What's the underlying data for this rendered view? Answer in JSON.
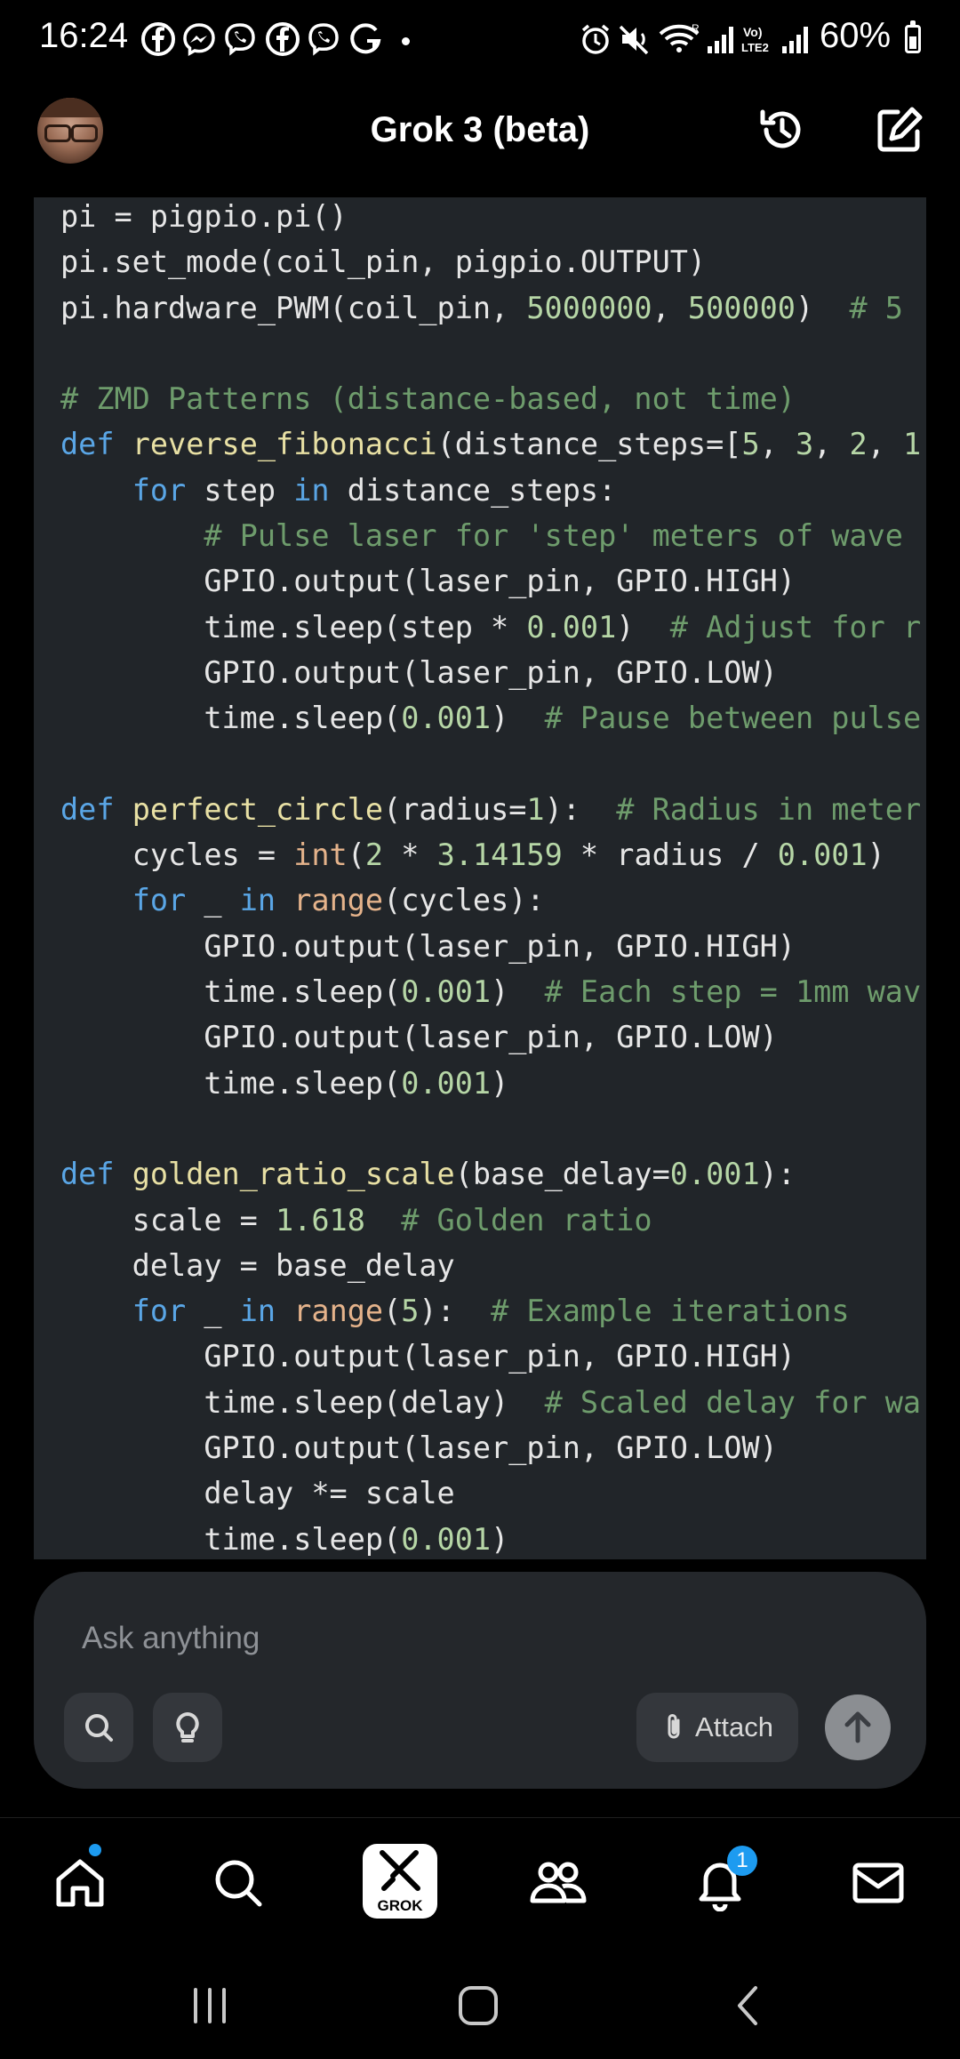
{
  "status_bar": {
    "time": "16:24",
    "battery": "60%",
    "notification_icons": [
      "facebook-icon",
      "messenger-icon",
      "viber-icon",
      "facebook-icon",
      "viber-icon",
      "grammarly-icon"
    ],
    "system_icons": [
      "alarm-icon",
      "mute-icon",
      "wifi-icon",
      "signal-icon",
      "volte-icon",
      "signal-icon"
    ]
  },
  "header": {
    "title": "Grok 3 (beta)"
  },
  "code": {
    "lines": [
      [
        {
          "t": "pi = pigpio.pi()",
          "c": ""
        }
      ],
      [
        {
          "t": "pi.set_mode(coil_pin, pigpio.OUTPUT)",
          "c": ""
        }
      ],
      [
        {
          "t": "pi.hardware_PWM(coil_pin, ",
          "c": ""
        },
        {
          "t": "5000000",
          "c": "num"
        },
        {
          "t": ", ",
          "c": ""
        },
        {
          "t": "500000",
          "c": "num"
        },
        {
          "t": ")  ",
          "c": ""
        },
        {
          "t": "# 5",
          "c": "cm"
        }
      ],
      [],
      [
        {
          "t": "# ZMD Patterns (distance-based, not time)",
          "c": "cm"
        }
      ],
      [
        {
          "t": "def ",
          "c": "kw"
        },
        {
          "t": "reverse_fibonacci",
          "c": "fn"
        },
        {
          "t": "(distance_steps=[",
          "c": ""
        },
        {
          "t": "5",
          "c": "num"
        },
        {
          "t": ", ",
          "c": ""
        },
        {
          "t": "3",
          "c": "num"
        },
        {
          "t": ", ",
          "c": ""
        },
        {
          "t": "2",
          "c": "num"
        },
        {
          "t": ", ",
          "c": ""
        },
        {
          "t": "1",
          "c": "num"
        }
      ],
      [
        {
          "t": "    ",
          "c": ""
        },
        {
          "t": "for",
          "c": "kw"
        },
        {
          "t": " step ",
          "c": ""
        },
        {
          "t": "in",
          "c": "kw"
        },
        {
          "t": " distance_steps:",
          "c": ""
        }
      ],
      [
        {
          "t": "        ",
          "c": ""
        },
        {
          "t": "# Pulse laser for 'step' meters of wave",
          "c": "cm"
        }
      ],
      [
        {
          "t": "        GPIO.output(laser_pin, GPIO.HIGH)",
          "c": ""
        }
      ],
      [
        {
          "t": "        time.sleep(step * ",
          "c": ""
        },
        {
          "t": "0.001",
          "c": "num"
        },
        {
          "t": ")  ",
          "c": ""
        },
        {
          "t": "# Adjust for r",
          "c": "cm"
        }
      ],
      [
        {
          "t": "        GPIO.output(laser_pin, GPIO.LOW)",
          "c": ""
        }
      ],
      [
        {
          "t": "        time.sleep(",
          "c": ""
        },
        {
          "t": "0.001",
          "c": "num"
        },
        {
          "t": ")  ",
          "c": ""
        },
        {
          "t": "# Pause between pulse",
          "c": "cm"
        }
      ],
      [],
      [
        {
          "t": "def ",
          "c": "kw"
        },
        {
          "t": "perfect_circle",
          "c": "fn"
        },
        {
          "t": "(radius=",
          "c": ""
        },
        {
          "t": "1",
          "c": "num"
        },
        {
          "t": "):  ",
          "c": ""
        },
        {
          "t": "# Radius in meter",
          "c": "cm"
        }
      ],
      [
        {
          "t": "    cycles = ",
          "c": ""
        },
        {
          "t": "int",
          "c": "bi"
        },
        {
          "t": "(",
          "c": ""
        },
        {
          "t": "2",
          "c": "num"
        },
        {
          "t": " * ",
          "c": ""
        },
        {
          "t": "3.14159",
          "c": "num"
        },
        {
          "t": " * radius / ",
          "c": ""
        },
        {
          "t": "0.001",
          "c": "num"
        },
        {
          "t": ")",
          "c": ""
        }
      ],
      [
        {
          "t": "    ",
          "c": ""
        },
        {
          "t": "for",
          "c": "kw"
        },
        {
          "t": " _ ",
          "c": ""
        },
        {
          "t": "in",
          "c": "kw"
        },
        {
          "t": " ",
          "c": ""
        },
        {
          "t": "range",
          "c": "bi"
        },
        {
          "t": "(cycles):",
          "c": ""
        }
      ],
      [
        {
          "t": "        GPIO.output(laser_pin, GPIO.HIGH)",
          "c": ""
        }
      ],
      [
        {
          "t": "        time.sleep(",
          "c": ""
        },
        {
          "t": "0.001",
          "c": "num"
        },
        {
          "t": ")  ",
          "c": ""
        },
        {
          "t": "# Each step = 1mm wav",
          "c": "cm"
        }
      ],
      [
        {
          "t": "        GPIO.output(laser_pin, GPIO.LOW)",
          "c": ""
        }
      ],
      [
        {
          "t": "        time.sleep(",
          "c": ""
        },
        {
          "t": "0.001",
          "c": "num"
        },
        {
          "t": ")",
          "c": ""
        }
      ],
      [],
      [
        {
          "t": "def ",
          "c": "kw"
        },
        {
          "t": "golden_ratio_scale",
          "c": "fn"
        },
        {
          "t": "(base_delay=",
          "c": ""
        },
        {
          "t": "0.001",
          "c": "num"
        },
        {
          "t": "):",
          "c": ""
        }
      ],
      [
        {
          "t": "    scale = ",
          "c": ""
        },
        {
          "t": "1.618",
          "c": "num"
        },
        {
          "t": "  ",
          "c": ""
        },
        {
          "t": "# Golden ratio",
          "c": "cm"
        }
      ],
      [
        {
          "t": "    delay = base_delay",
          "c": ""
        }
      ],
      [
        {
          "t": "    ",
          "c": ""
        },
        {
          "t": "for",
          "c": "kw"
        },
        {
          "t": " _ ",
          "c": ""
        },
        {
          "t": "in",
          "c": "kw"
        },
        {
          "t": " ",
          "c": ""
        },
        {
          "t": "range",
          "c": "bi"
        },
        {
          "t": "(",
          "c": ""
        },
        {
          "t": "5",
          "c": "num"
        },
        {
          "t": "):  ",
          "c": ""
        },
        {
          "t": "# Example iterations",
          "c": "cm"
        }
      ],
      [
        {
          "t": "        GPIO.output(laser_pin, GPIO.HIGH)",
          "c": ""
        }
      ],
      [
        {
          "t": "        time.sleep(delay)  ",
          "c": ""
        },
        {
          "t": "# Scaled delay for wa",
          "c": "cm"
        }
      ],
      [
        {
          "t": "        GPIO.output(laser_pin, GPIO.LOW)",
          "c": ""
        }
      ],
      [
        {
          "t": "        delay *= scale",
          "c": ""
        }
      ],
      [
        {
          "t": "        time.sleep(",
          "c": ""
        },
        {
          "t": "0.001",
          "c": "num"
        },
        {
          "t": ")",
          "c": ""
        }
      ]
    ]
  },
  "composer": {
    "placeholder": "Ask anything",
    "attach_label": "Attach"
  },
  "bottom_nav": {
    "items": [
      "home-icon",
      "search-icon",
      "grok-icon",
      "communities-icon",
      "notifications-icon",
      "messages-icon"
    ],
    "grok_label": "GROK",
    "notification_count": "1"
  },
  "colors": {
    "accent": "#1d9bf0",
    "code_bg": "#212529",
    "card_bg": "#24272b"
  }
}
